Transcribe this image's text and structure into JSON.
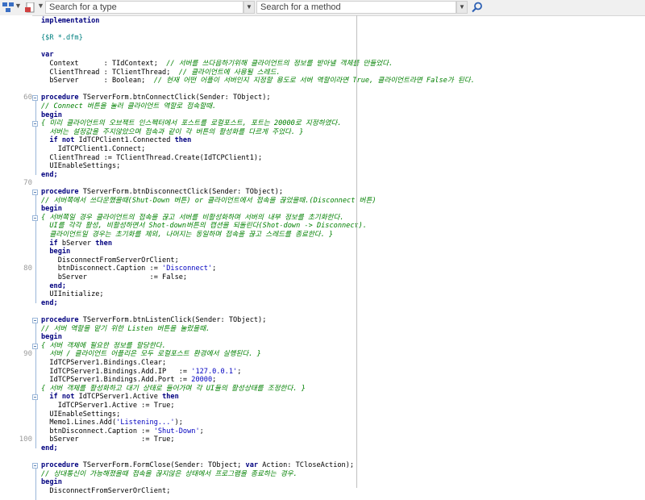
{
  "toolbar": {
    "type_search_placeholder": "Search for a type",
    "method_search_placeholder": "Search for a method"
  },
  "editor": {
    "line_numbers": [
      {
        "n": "",
        "row": 0
      },
      {
        "n": "",
        "row": 1
      },
      {
        "n": "",
        "row": 2
      },
      {
        "n": "",
        "row": 3
      },
      {
        "n": "",
        "row": 4
      },
      {
        "n": "",
        "row": 5
      },
      {
        "n": "",
        "row": 6
      },
      {
        "n": "",
        "row": 7
      },
      {
        "n": "",
        "row": 8
      },
      {
        "n": "60",
        "row": 9
      },
      {
        "n": "70",
        "row": 19
      },
      {
        "n": "80",
        "row": 29
      },
      {
        "n": "90",
        "row": 39
      },
      {
        "n": "100",
        "row": 49
      }
    ],
    "lines": [
      [
        {
          "t": "implementation",
          "c": "kw"
        }
      ],
      [
        {
          "t": "",
          "c": ""
        }
      ],
      [
        {
          "t": "{$R *.dfm}",
          "c": "dir"
        }
      ],
      [
        {
          "t": "",
          "c": ""
        }
      ],
      [
        {
          "t": "var",
          "c": "kw"
        }
      ],
      [
        {
          "t": "  Context      : TIdContext;  ",
          "c": ""
        },
        {
          "t": "// 서버를 쓰다음하기위해 클라이언트의 정보를 받아낼 객체를 만들었다.",
          "c": "cm"
        }
      ],
      [
        {
          "t": "  ClientThread : TClientThread;  ",
          "c": ""
        },
        {
          "t": "// 클라이언트에 사용될 스레드.",
          "c": "cm"
        }
      ],
      [
        {
          "t": "  bServer      : Boolean;  ",
          "c": ""
        },
        {
          "t": "// 현재 어떤 어플이 서버인지 지정할 용도로 서버 역할이라면 True, 클라이언트라면 False가 된다.",
          "c": "cm"
        }
      ],
      [
        {
          "t": "",
          "c": ""
        }
      ],
      [
        {
          "t": "procedure ",
          "c": "kw"
        },
        {
          "t": "TServerForm.btnConnectClick(Sender: TObject);",
          "c": ""
        }
      ],
      [
        {
          "t": "// Connect 버튼을 눌러 클라이언트 역할로 접속할때.",
          "c": "cm"
        }
      ],
      [
        {
          "t": "begin",
          "c": "kw"
        }
      ],
      [
        {
          "t": "{ 미리 클라이언트의 오브젝트 인스펙터에서 포스트를 로컬포스트, 포트는 20000로 지정하였다.",
          "c": "cm"
        }
      ],
      [
        {
          "t": "  서버는 설정값을 주지않았으며 접속과 같이 각 버튼의 활성화를 다르게 주었다. }",
          "c": "cm"
        }
      ],
      [
        {
          "t": "  ",
          "c": ""
        },
        {
          "t": "if not ",
          "c": "kw"
        },
        {
          "t": "IdTCPClient1.Connected ",
          "c": ""
        },
        {
          "t": "then",
          "c": "kw"
        }
      ],
      [
        {
          "t": "    IdTCPClient1.Connect;",
          "c": ""
        }
      ],
      [
        {
          "t": "  ClientThread := TClientThread.Create(IdTCPClient1);",
          "c": ""
        }
      ],
      [
        {
          "t": "  UIEnableSettings;",
          "c": ""
        }
      ],
      [
        {
          "t": "end;",
          "c": "kw"
        }
      ],
      [
        {
          "t": "",
          "c": ""
        }
      ],
      [
        {
          "t": "procedure ",
          "c": "kw"
        },
        {
          "t": "TServerForm.btnDisconnectClick(Sender: TObject);",
          "c": ""
        }
      ],
      [
        {
          "t": "// 서버쪽에서 쓰다운했을때(Shut-Down 버튼) or 클라이언트에서 접속을 끊었을때.(Disconnect 버튼)",
          "c": "cm"
        }
      ],
      [
        {
          "t": "begin",
          "c": "kw"
        }
      ],
      [
        {
          "t": "{ 서버쪽일 경우 클라이언트의 접속을 끊고 서버를 비활성화하며 서버의 내부 정보를 초기화한다.",
          "c": "cm"
        }
      ],
      [
        {
          "t": "  UI를 각각 활성, 비활성하면서 Shot-down버튼의 캡션을 되돌린다(Shot-down -> Disconnect).",
          "c": "cm"
        }
      ],
      [
        {
          "t": "  클라이언트일 경우는 초기화를 제외, 나머지는 동일하며 접속을 끊고 스레드를 종료한다. }",
          "c": "cm"
        }
      ],
      [
        {
          "t": "  ",
          "c": ""
        },
        {
          "t": "if ",
          "c": "kw"
        },
        {
          "t": "bServer ",
          "c": ""
        },
        {
          "t": "then",
          "c": "kw"
        }
      ],
      [
        {
          "t": "  ",
          "c": ""
        },
        {
          "t": "begin",
          "c": "kw"
        }
      ],
      [
        {
          "t": "    DisconnectFromServerOrClient;",
          "c": ""
        }
      ],
      [
        {
          "t": "    btnDisconnect.Caption := ",
          "c": ""
        },
        {
          "t": "'Disconnect'",
          "c": "st"
        },
        {
          "t": ";",
          "c": ""
        }
      ],
      [
        {
          "t": "    bServer               := False;",
          "c": ""
        }
      ],
      [
        {
          "t": "  ",
          "c": ""
        },
        {
          "t": "end;",
          "c": "kw"
        }
      ],
      [
        {
          "t": "  UIInitialize;",
          "c": ""
        }
      ],
      [
        {
          "t": "end;",
          "c": "kw"
        }
      ],
      [
        {
          "t": "",
          "c": ""
        }
      ],
      [
        {
          "t": "procedure ",
          "c": "kw"
        },
        {
          "t": "TServerForm.btnListenClick(Sender: TObject);",
          "c": ""
        }
      ],
      [
        {
          "t": "// 서버 역할을 맡기 위한 Listen 버튼을 눌렀을때.",
          "c": "cm"
        }
      ],
      [
        {
          "t": "begin",
          "c": "kw"
        }
      ],
      [
        {
          "t": "{ 서버 객체에 필요한 정보를 할당한다.",
          "c": "cm"
        }
      ],
      [
        {
          "t": "  서버 / 클라이언트 어플리은 모두 로컬포스트 환경에서 실행된다. }",
          "c": "cm"
        }
      ],
      [
        {
          "t": "  IdTCPServer1.Bindings.Clear;",
          "c": ""
        }
      ],
      [
        {
          "t": "  IdTCPServer1.Bindings.Add.IP   := ",
          "c": ""
        },
        {
          "t": "'127.0.0.1'",
          "c": "st"
        },
        {
          "t": ";",
          "c": ""
        }
      ],
      [
        {
          "t": "  IdTCPServer1.Bindings.Add.Port := ",
          "c": ""
        },
        {
          "t": "20000",
          "c": "num"
        },
        {
          "t": ";",
          "c": ""
        }
      ],
      [
        {
          "t": "{ 서버 객체를 활성화하고 대기 상태로 들어가며 각 UI들의 활성상태를 조정한다. }",
          "c": "cm"
        }
      ],
      [
        {
          "t": "  ",
          "c": ""
        },
        {
          "t": "if not ",
          "c": "kw"
        },
        {
          "t": "IdTCPServer1.Active ",
          "c": ""
        },
        {
          "t": "then",
          "c": "kw"
        }
      ],
      [
        {
          "t": "    IdTCPServer1.Active := True;",
          "c": ""
        }
      ],
      [
        {
          "t": "  UIEnableSettings;",
          "c": ""
        }
      ],
      [
        {
          "t": "  Memo1.Lines.Add(",
          "c": ""
        },
        {
          "t": "'Listening...'",
          "c": "st"
        },
        {
          "t": ");",
          "c": ""
        }
      ],
      [
        {
          "t": "  btnDisconnect.Caption := ",
          "c": ""
        },
        {
          "t": "'Shut-Down'",
          "c": "st"
        },
        {
          "t": ";",
          "c": ""
        }
      ],
      [
        {
          "t": "  bServer               := True;",
          "c": ""
        }
      ],
      [
        {
          "t": "end;",
          "c": "kw"
        }
      ],
      [
        {
          "t": "",
          "c": ""
        }
      ],
      [
        {
          "t": "procedure ",
          "c": "kw"
        },
        {
          "t": "TServerForm.FormClose(Sender: TObject; ",
          "c": ""
        },
        {
          "t": "var ",
          "c": "kw"
        },
        {
          "t": "Action: TCloseAction);",
          "c": ""
        }
      ],
      [
        {
          "t": "// 상대통신이 가능해졌을때 접속을 끊지않은 상태에서 프로그램을 종료하는 경우.",
          "c": "cm"
        }
      ],
      [
        {
          "t": "begin",
          "c": "kw"
        }
      ],
      [
        {
          "t": "  DisconnectFromServerOrClient;",
          "c": ""
        }
      ]
    ]
  }
}
